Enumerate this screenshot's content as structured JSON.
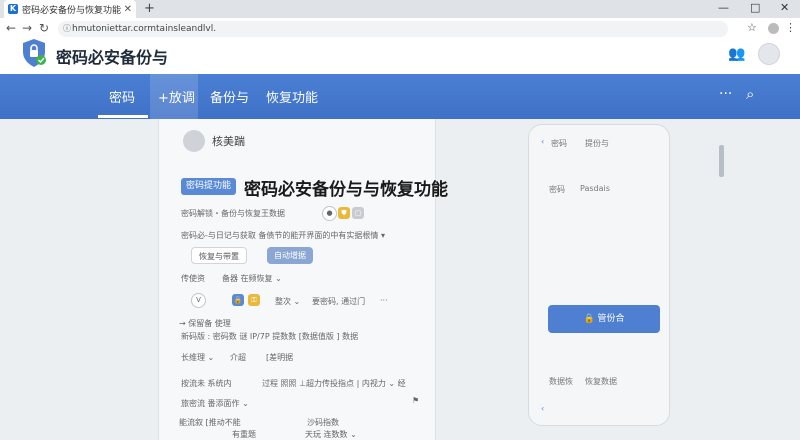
{
  "browser": {
    "tab_title": "密码必安备份与恢复功能",
    "tab_close": "✕",
    "new_tab": "+",
    "url": "hmutoniettar.cormtainsleandlvl.",
    "window_controls": [
      "—",
      "□",
      "✕"
    ]
  },
  "site": {
    "title": "密码必安备份与",
    "nav": {
      "items": [
        "密码",
        "+放调",
        "备份与",
        "恢复功能"
      ],
      "active_index": 0
    }
  },
  "card": {
    "user_name": "核美踹",
    "badge": "密码提功能",
    "title": "密码必安备份与与恢复功能",
    "rows": {
      "r1": "密码解锁・备份与恢复王数据",
      "r2": "密码必-与日记与获取   备债节的能开界面的中有实据根情 ▾",
      "pill_restore": "恢复与带置",
      "pill_auto": "自动增据",
      "r4_a": "传使资",
      "r4_b": "备器  在频恢复 ⌄",
      "r5_v": "V",
      "r5_a": "整次 ⌄",
      "r5_b": "要密码, 通过门",
      "r5_more": "···",
      "r6_a": "→ 保留备 使理",
      "r6_b": "新码版 : 密码数   谜  IP/7P   提数数 [数据值版 ] 数据",
      "r7_a": "长维理 ⌄",
      "r7_b": "介超",
      "r7_c": "[差明据",
      "r8_a": "按流未 系统内",
      "r8_b": "过程   照照   ⊥超力传投指点 | 内视力 ⌄ 经",
      "r9": "旅密流 番添面作 ⌄",
      "r10_a": "能流叙 [推动不能",
      "r10_b": "沙码指数",
      "r11_a": "有重题",
      "r11_b": "天玩 连数数 ⌄"
    }
  },
  "phone": {
    "header_a": "密码",
    "header_b": "提份与",
    "field_label": "密码",
    "field_hint": "Pasdais",
    "cta": "🔒 管份合",
    "footer_a": "数据恢",
    "footer_b": "恢复数据"
  },
  "icons": {
    "logo": "shield-check-icon",
    "user": "user-group-icon",
    "more": "more-horizontal-icon",
    "search": "search-icon"
  },
  "colors": {
    "nav_blue": "#4478cf",
    "badge_blue": "#5a8ad6",
    "cta_blue": "#4f7fd1"
  }
}
